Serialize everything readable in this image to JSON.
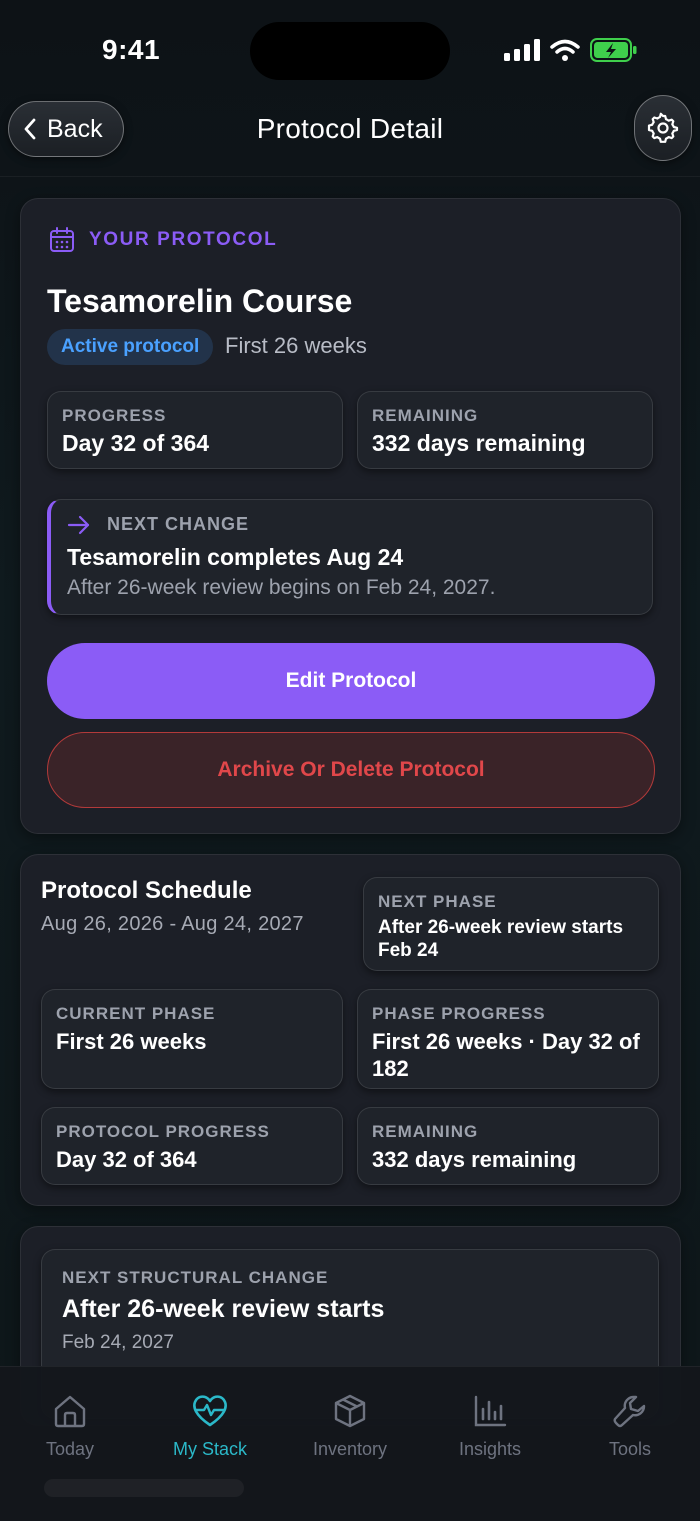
{
  "status": {
    "time": "9:41"
  },
  "header": {
    "back_label": "Back",
    "title": "Protocol Detail"
  },
  "protocol": {
    "eyebrow": "YOUR PROTOCOL",
    "name": "Tesamorelin Course",
    "badge": "Active protocol",
    "phase_text": "First 26 weeks",
    "progress_label": "PROGRESS",
    "progress_value": "Day 32 of 364",
    "remaining_label": "REMAINING",
    "remaining_value": "332 days remaining",
    "next_change_label": "NEXT CHANGE",
    "next_change_title": "Tesamorelin completes Aug 24",
    "next_change_sub": "After 26-week review begins on Feb 24, 2027.",
    "edit_label": "Edit Protocol",
    "archive_label": "Archive Or Delete Protocol"
  },
  "schedule": {
    "title": "Protocol Schedule",
    "range": "Aug 26, 2026 - Aug 24, 2027",
    "next_phase_label": "NEXT PHASE",
    "next_phase_value": "After 26-week review starts Feb 24",
    "current_phase_label": "CURRENT PHASE",
    "current_phase_value": "First 26 weeks",
    "phase_progress_label": "PHASE PROGRESS",
    "phase_progress_value": "First 26 weeks · Day 32 of 182",
    "protocol_progress_label": "PROTOCOL PROGRESS",
    "protocol_progress_value": "Day 32 of 364",
    "remaining_label": "REMAINING",
    "remaining_value": "332 days remaining"
  },
  "structural": {
    "label": "NEXT STRUCTURAL CHANGE",
    "title": "After 26-week review starts",
    "date": "Feb 24, 2027"
  },
  "tabs": [
    {
      "label": "Today",
      "icon": "home-icon"
    },
    {
      "label": "My Stack",
      "icon": "heart-pulse-icon"
    },
    {
      "label": "Inventory",
      "icon": "box-icon"
    },
    {
      "label": "Insights",
      "icon": "bar-chart-icon"
    },
    {
      "label": "Tools",
      "icon": "wrench-icon"
    }
  ],
  "colors": {
    "accent": "#8b5cf6",
    "active_tab": "#2bb8c8",
    "danger": "#e0474a",
    "badge": "#4aa1ff"
  }
}
